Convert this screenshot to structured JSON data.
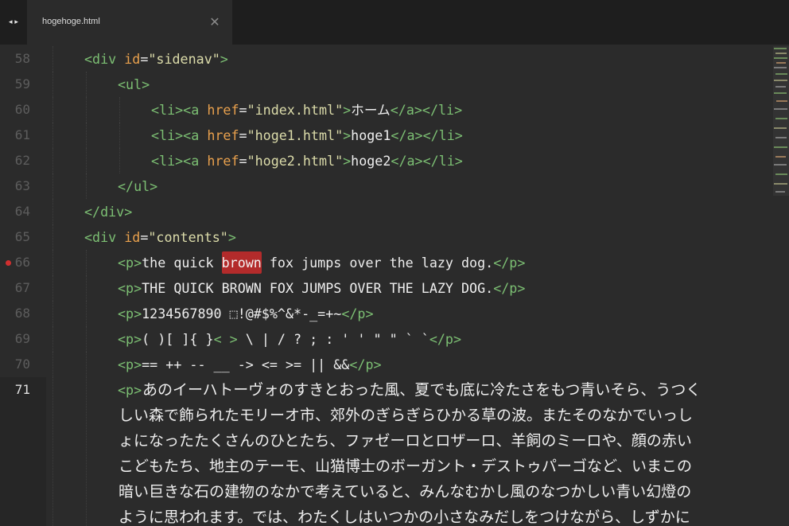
{
  "tab": {
    "nav_arrows": "◂ ▸",
    "filename": "hogehoge.html",
    "close_glyph": "✕"
  },
  "gutter": {
    "line_numbers": [
      "58",
      "59",
      "60",
      "61",
      "62",
      "63",
      "64",
      "65",
      "66",
      "67",
      "68",
      "69",
      "70",
      "71"
    ],
    "current_line": "71",
    "breakpoint_line": "66"
  },
  "code": {
    "l58": {
      "open": "<div ",
      "attr": "id",
      "eq": "=",
      "val": "\"sidenav\"",
      "close": ">"
    },
    "l59": {
      "tag": "<ul>"
    },
    "l60": {
      "a1": "<li><a ",
      "attr": "href",
      "eq": "=",
      "val": "\"index.html\"",
      "gt": ">",
      "text": "ホーム",
      "end": "</a></li>"
    },
    "l61": {
      "a1": "<li><a ",
      "attr": "href",
      "eq": "=",
      "val": "\"hoge1.html\"",
      "gt": ">",
      "text": "hoge1",
      "end": "</a></li>"
    },
    "l62": {
      "a1": "<li><a ",
      "attr": "href",
      "eq": "=",
      "val": "\"hoge2.html\"",
      "gt": ">",
      "text": "hoge2",
      "end": "</a></li>"
    },
    "l63": {
      "tag": "</ul>"
    },
    "l64": {
      "tag": "</div>"
    },
    "l65": {
      "open": "<div ",
      "attr": "id",
      "eq": "=",
      "val": "\"contents\"",
      "close": ">"
    },
    "l66": {
      "p_open": "<p>",
      "before": "the quick ",
      "highlight": "brown",
      "after": " fox jumps over the lazy dog.",
      "p_close": "</p>"
    },
    "l67": {
      "p_open": "<p>",
      "text": "THE QUICK BROWN FOX JUMPS OVER THE LAZY DOG.",
      "p_close": "</p>"
    },
    "l68": {
      "p_open": "<p>",
      "text": "1234567890 ⬚!@#$%^&*-_=+~",
      "p_close": "</p>"
    },
    "l69": {
      "p_open": "<p>",
      "text1": "( )[ ]{ }",
      "lt_gt": "< >",
      "text2": " \\ | / ? ; : ' ' \" \" ` `",
      "p_close": "</p>"
    },
    "l70": {
      "p_open": "<p>",
      "text": "== ++ -- __ -> <= >= || &&",
      "p_close": "</p>"
    },
    "l71": {
      "p_open": "<p>",
      "lines": [
        "あのイーハトーヴォのすきとおった風、夏でも底に冷たさをもつ青いそら、うつく",
        "しい森で飾られたモリーオ市、郊外のぎらぎらひかる草の波。またそのなかでいっし",
        "ょになったたくさんのひとたち、ファゼーロとロザーロ、羊飼のミーロや、顔の赤い",
        "こどもたち、地主のテーモ、山猫博士のボーガント・デストゥパーゴなど、いまこの",
        "暗い巨きな石の建物のなかで考えていると、みんなむかし風のなつかしい青い幻燈の",
        "ように思われます。では、わたくしはいつかの小さなみだしをつけながら、しずかに"
      ]
    }
  },
  "colors": {
    "background": "#2b2b2b",
    "tab_bar": "#1e1e1e",
    "tag": "#7cbf73",
    "attribute": "#e8a04d",
    "string": "#dcdcaa",
    "text": "#eeeeee",
    "highlight": "#b32b2b",
    "breakpoint": "#d12f2f",
    "line_number": "#5d5d5d"
  }
}
